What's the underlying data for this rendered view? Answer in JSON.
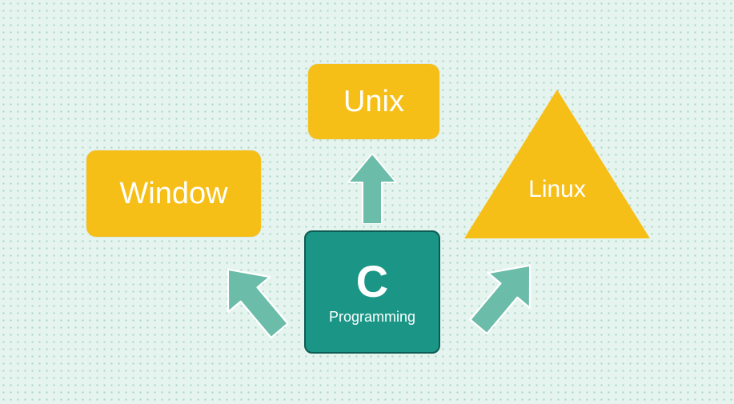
{
  "center": {
    "title": "C",
    "subtitle": "Programming"
  },
  "nodes": {
    "left": {
      "label": "Window"
    },
    "top": {
      "label": "Unix"
    },
    "right": {
      "label": "Linux"
    }
  },
  "colors": {
    "node_fill": "#f6bf17",
    "center_fill": "#1b9686",
    "arrow_fill": "#6bbca8"
  }
}
